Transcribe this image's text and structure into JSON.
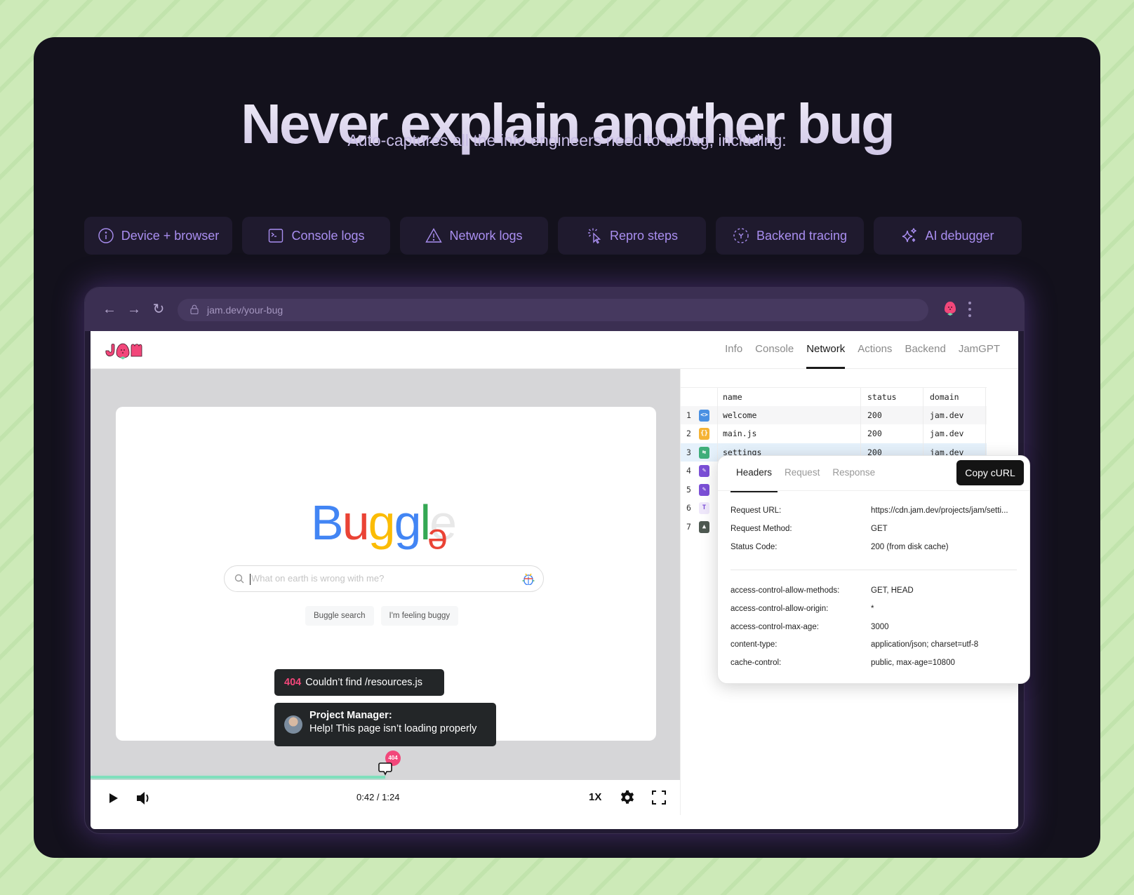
{
  "hero": {
    "title": "Never explain another bug",
    "subtitle": "Auto-captures all the info engineers need to debug, including:"
  },
  "features": [
    {
      "label": "Device + browser",
      "icon": "info-icon"
    },
    {
      "label": "Console logs",
      "icon": "terminal-icon"
    },
    {
      "label": "Network logs",
      "icon": "warning-icon"
    },
    {
      "label": "Repro steps",
      "icon": "cursor-click-icon"
    },
    {
      "label": "Backend tracing",
      "icon": "trace-icon"
    },
    {
      "label": "AI debugger",
      "icon": "sparkles-icon"
    }
  ],
  "browser": {
    "url": "jam.dev/your-bug"
  },
  "app": {
    "tabs": [
      {
        "label": "Info",
        "active": false
      },
      {
        "label": "Console",
        "active": false
      },
      {
        "label": "Network",
        "active": true
      },
      {
        "label": "Actions",
        "active": false
      },
      {
        "label": "Backend",
        "active": false
      },
      {
        "label": "JamGPT",
        "active": false
      }
    ]
  },
  "buggle": {
    "letters": [
      "B",
      "u",
      "g",
      "g",
      "l",
      "e"
    ],
    "colors": [
      "#4285f4",
      "#ea4335",
      "#fbbc05",
      "#4285f4",
      "#34a853",
      "#e8e8e8"
    ],
    "fallen_letter": "e",
    "fallen_color": "#ea4335",
    "search_placeholder": "What on earth is wrong with me?",
    "search_button": "Buggle search",
    "lucky_button": "I'm feeling buggy"
  },
  "toasts": {
    "error_code": "404",
    "error_text": "Couldn’t find /resources.js",
    "comment_author": "Project Manager:",
    "comment_text": "Help! This page isn’t loading properly"
  },
  "player": {
    "progress": 0.5,
    "marker_badge": "404",
    "time": "0:42 / 1:24",
    "speed": "1X"
  },
  "network": {
    "columns": [
      "name",
      "status",
      "domain"
    ],
    "rows": [
      {
        "index": "1",
        "type": "html",
        "name": "welcome",
        "status": "200",
        "domain": "jam.dev",
        "color": "#4a90e2",
        "glyph": "<>"
      },
      {
        "index": "2",
        "type": "js",
        "name": "main.js",
        "status": "200",
        "domain": "jam.dev",
        "color": "#f5b335",
        "glyph": "{}"
      },
      {
        "index": "3",
        "type": "fetch",
        "name": "settings",
        "status": "200",
        "domain": "jam.dev",
        "color": "#3fae7a",
        "glyph": "⇆",
        "selected": true
      },
      {
        "index": "4",
        "type": "css",
        "name": "",
        "status": "",
        "domain": "",
        "color": "#7b4fd6",
        "glyph": "✎"
      },
      {
        "index": "5",
        "type": "css",
        "name": "",
        "status": "",
        "domain": "",
        "color": "#7b4fd6",
        "glyph": "✎"
      },
      {
        "index": "6",
        "type": "font",
        "name": "",
        "status": "",
        "domain": "",
        "color": "#efe8fb",
        "glyph": "T"
      },
      {
        "index": "7",
        "type": "image",
        "name": "",
        "status": "",
        "domain": "",
        "color": "#4f5a52",
        "glyph": "▲"
      }
    ]
  },
  "details": {
    "tabs": [
      {
        "label": "Headers",
        "active": true
      },
      {
        "label": "Request",
        "active": false
      },
      {
        "label": "Response",
        "active": false
      }
    ],
    "copy_button": "Copy cURL",
    "general": [
      {
        "key": "Request URL:",
        "value": "https://cdn.jam.dev/projects/jam/setti..."
      },
      {
        "key": "Request Method:",
        "value": "GET"
      },
      {
        "key": "Status Code:",
        "value": "200 (from disk cache)"
      }
    ],
    "headers": [
      {
        "key": "access-control-allow-methods:",
        "value": "GET, HEAD"
      },
      {
        "key": "access-control-allow-origin:",
        "value": "*"
      },
      {
        "key": "access-control-max-age:",
        "value": "3000"
      },
      {
        "key": "content-type:",
        "value": "application/json; charset=utf-8"
      },
      {
        "key": "cache-control:",
        "value": "public, max-age=10800"
      }
    ]
  }
}
